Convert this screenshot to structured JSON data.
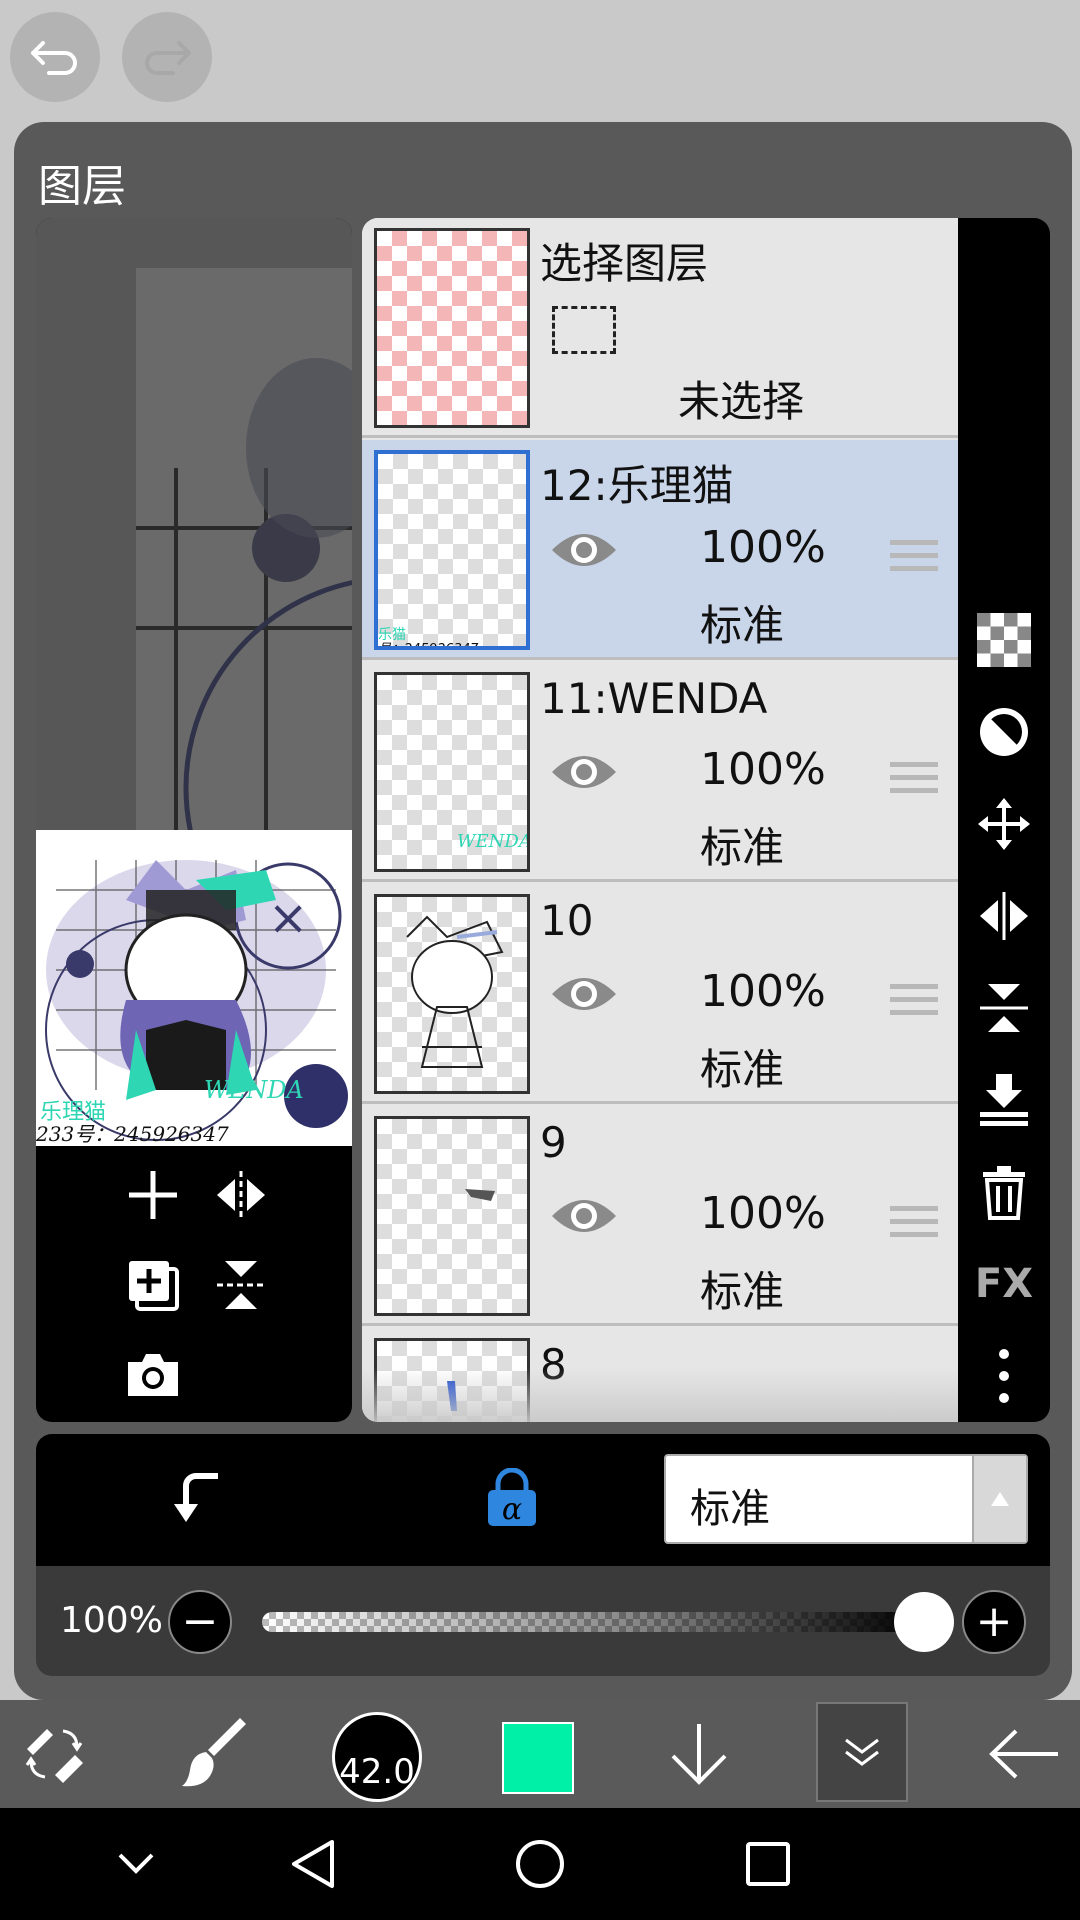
{
  "panel": {
    "title": "图层"
  },
  "selection_layer": {
    "title": "选择图层",
    "status": "未选择"
  },
  "layers": [
    {
      "name": "12:乐理猫",
      "opacity": "100%",
      "blend": "标准",
      "selected": true
    },
    {
      "name": "11:WENDA",
      "opacity": "100%",
      "blend": "标准",
      "selected": false
    },
    {
      "name": "10",
      "opacity": "100%",
      "blend": "标准",
      "selected": false
    },
    {
      "name": "9",
      "opacity": "100%",
      "blend": "标准",
      "selected": false
    },
    {
      "name": "8",
      "opacity": "",
      "blend": "",
      "selected": false
    }
  ],
  "thumbnail_text": {
    "line1": "乐理猫",
    "line2": "233号：245926347",
    "wenda": "WENDA",
    "layer12_line1": "乐猫",
    "layer12_line2": "号：245926347",
    "layer11": "WENDA"
  },
  "right_toolbar": {
    "fx_label": "FX"
  },
  "blend_mode": {
    "value": "标准"
  },
  "opacity_row": {
    "label": "100%",
    "value_percent": 100
  },
  "brush": {
    "size_label": "42.0"
  },
  "colors": {
    "current": "#00f0a8",
    "selected_layer_bg": "#c9d6ea",
    "accent_blue": "#2e86de"
  },
  "icons": [
    "undo-icon",
    "redo-icon",
    "eye-icon",
    "drag-handle-icon",
    "transparency-icon",
    "invert-icon",
    "move-icon",
    "flip-horizontal-icon",
    "flip-vertical-icon",
    "merge-down-icon",
    "trash-icon",
    "fx-icon",
    "more-vertical-icon",
    "add-layer-icon",
    "copy-layer-icon",
    "camera-icon",
    "clipping-icon",
    "alpha-lock-icon",
    "tool-swap-icon",
    "brush-icon",
    "arrow-down-icon",
    "chevron-double-down-icon",
    "back-arrow-icon"
  ]
}
